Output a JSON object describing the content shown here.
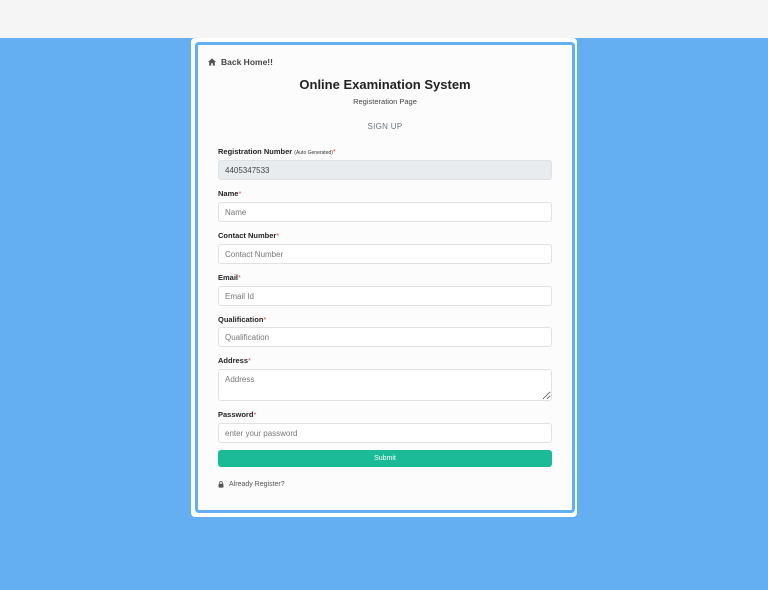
{
  "nav": {
    "back_home": "Back Home!!"
  },
  "header": {
    "title": "Online Examination System",
    "subtitle": "Registeration Page",
    "section": "SIGN UP"
  },
  "form": {
    "registration": {
      "label": "Registration Number",
      "note": "(Auto Generated)",
      "required": "*",
      "value": "4405347533"
    },
    "name": {
      "label": "Name",
      "required": "*",
      "placeholder": "Name"
    },
    "contact": {
      "label": "Contact Number",
      "required": "*",
      "placeholder": "Contact Number"
    },
    "email": {
      "label": "Email",
      "required": "*",
      "placeholder": "Email Id"
    },
    "qualification": {
      "label": "Qualification",
      "required": "*",
      "placeholder": "Qualification"
    },
    "address": {
      "label": "Address",
      "required": "*",
      "placeholder": "Address"
    },
    "password": {
      "label": "Password",
      "required": "*",
      "placeholder": "enter your password"
    },
    "submit_label": "Submit",
    "already_register": "Already Register?"
  },
  "colors": {
    "background": "#64aef2",
    "accent": "#1cbb97",
    "required": "#e04646"
  }
}
